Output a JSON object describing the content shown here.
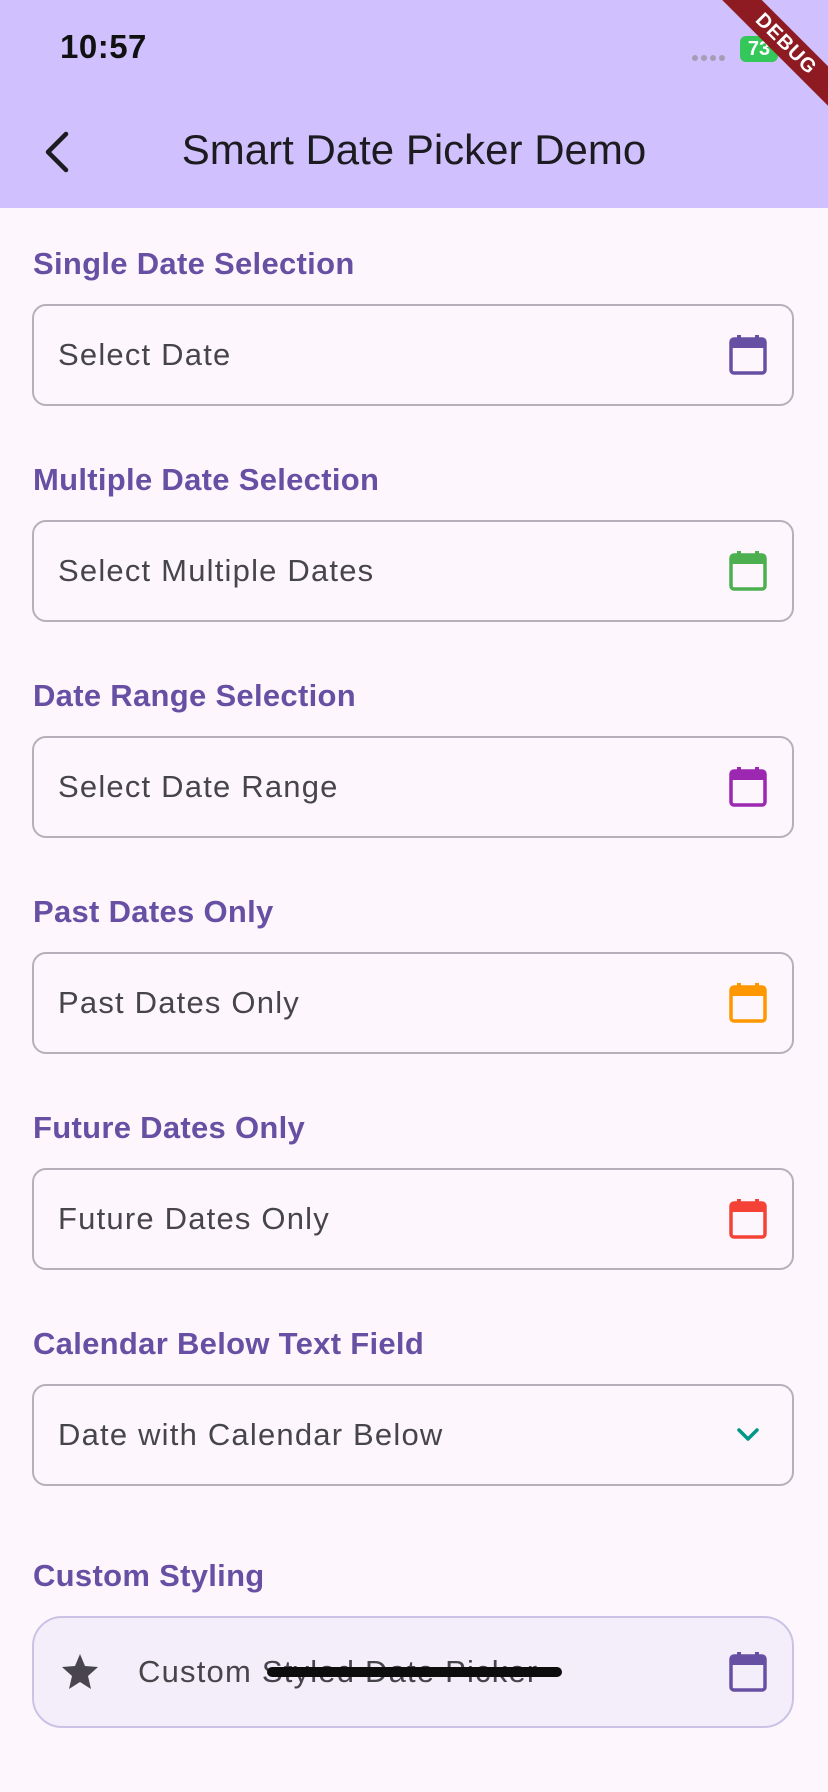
{
  "status_bar": {
    "time": "10:57",
    "battery": "73",
    "debug_banner": "DEBUG"
  },
  "app_bar": {
    "title": "Smart Date Picker Demo",
    "back_icon": "chevron-left-icon"
  },
  "sections": [
    {
      "label": "Single Date Selection",
      "hint": "Select Date",
      "icon": "calendar-icon",
      "icon_color": "#6750a4"
    },
    {
      "label": "Multiple Date Selection",
      "hint": "Select Multiple Dates",
      "icon": "calendar-icon",
      "icon_color": "#4caf50"
    },
    {
      "label": "Date Range Selection",
      "hint": "Select Date Range",
      "icon": "calendar-icon",
      "icon_color": "#9c27b0"
    },
    {
      "label": "Past Dates Only",
      "hint": "Past Dates Only",
      "icon": "calendar-icon",
      "icon_color": "#ff9800"
    },
    {
      "label": "Future Dates Only",
      "hint": "Future Dates Only",
      "icon": "calendar-icon",
      "icon_color": "#f44336"
    },
    {
      "label": "Calendar Below Text Field",
      "hint": "Date with Calendar Below",
      "icon": "chevron-down-icon",
      "icon_color": "#009688"
    },
    {
      "label": "Custom Styling",
      "hint": "Custom Styled Date Picker",
      "icon": "calendar-icon",
      "icon_color": "#6750a4",
      "prefix_icon": "star-icon"
    }
  ],
  "colors": {
    "app_bar": "#d0c1fe",
    "background": "#fdf7fd",
    "section_label": "#6750a4",
    "custom_field_fill": "#f3eef9"
  }
}
